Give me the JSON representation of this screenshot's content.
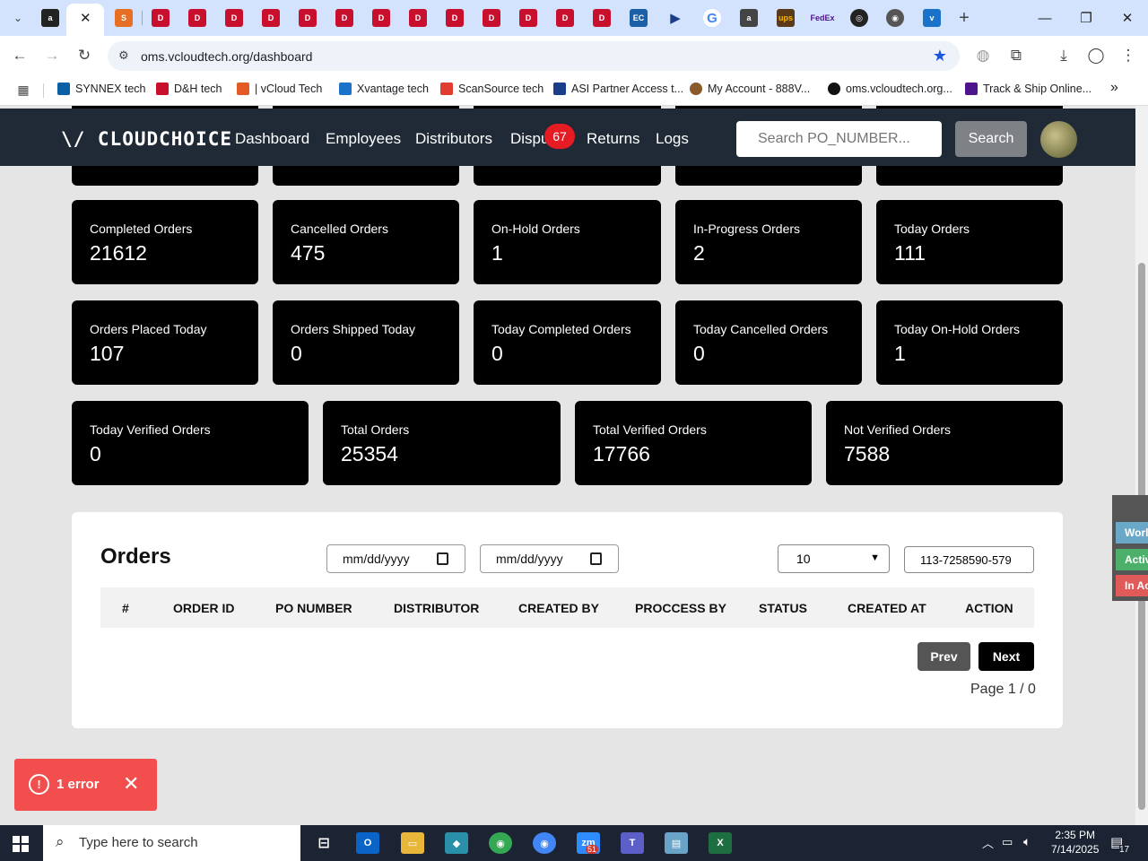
{
  "browser": {
    "url": "oms.vcloudtech.org/dashboard",
    "tab_icons": [
      "amazon-icon",
      "close-icon",
      "scansource-icon",
      "dh-icon",
      "dh-icon",
      "dh-icon",
      "dh-icon",
      "dh-icon",
      "dh-icon",
      "dh-icon",
      "dh-icon",
      "dh-icon",
      "dh-icon",
      "dh-icon",
      "dh-icon",
      "ec-icon",
      "play-icon",
      "google-icon",
      "amazon-icon",
      "ups-icon",
      "fedex-icon",
      "openai-icon",
      "chrome-icon",
      "vcloud-icon",
      "plus-icon"
    ],
    "bookmarks": [
      {
        "label": "SYNNEX tech",
        "color": "#0b5fa5"
      },
      {
        "label": "D&H tech",
        "color": "#c8102e"
      },
      {
        "label": "| vCloud Tech",
        "color": "#e25b24"
      },
      {
        "label": "Xvantage tech",
        "color": "#1a73c9"
      },
      {
        "label": "ScanSource tech",
        "color": "#e03c31"
      },
      {
        "label": "ASI Partner Access t...",
        "color": "#1a3e8a"
      },
      {
        "label": "My Account - 888V...",
        "color": "#8a5a2b"
      },
      {
        "label": "oms.vcloudtech.org...",
        "color": "#111111"
      },
      {
        "label": "Track & Ship Online...",
        "color": "#4d148c"
      }
    ],
    "bookmarks_more": "»"
  },
  "navbar": {
    "logo": "\\/ CLOUDCHOICE",
    "links": [
      "Dashboard",
      "Employees",
      "Distributors",
      "Dispu",
      "Returns",
      "Logs"
    ],
    "disputes_badge": "67",
    "search_placeholder": "Search PO_NUMBER...",
    "search_button": "Search"
  },
  "stats": [
    {
      "label": "Completed Orders",
      "value": "21612"
    },
    {
      "label": "Cancelled Orders",
      "value": "475"
    },
    {
      "label": "On-Hold Orders",
      "value": "1"
    },
    {
      "label": "In-Progress Orders",
      "value": "2"
    },
    {
      "label": "Today Orders",
      "value": "111"
    },
    {
      "label": "Orders Placed Today",
      "value": "107"
    },
    {
      "label": "Orders Shipped Today",
      "value": "0"
    },
    {
      "label": "Today Completed Orders",
      "value": "0"
    },
    {
      "label": "Today Cancelled Orders",
      "value": "0"
    },
    {
      "label": "Today On-Hold Orders",
      "value": "1"
    },
    {
      "label": "Today Verified Orders",
      "value": "0"
    },
    {
      "label": "Total Orders",
      "value": "25354"
    },
    {
      "label": "Total Verified Orders",
      "value": "17766"
    },
    {
      "label": "Not Verified Orders",
      "value": "7588"
    }
  ],
  "orders": {
    "title": "Orders",
    "date_from_placeholder": "mm/dd/yyyy",
    "date_to_placeholder": "mm/dd/yyyy",
    "page_size": "10",
    "filter_value": "113-7258590-579",
    "columns": [
      "#",
      "ORDER ID",
      "PO NUMBER",
      "DISTRIBUTOR",
      "CREATED BY",
      "PROCCESS BY",
      "STATUS",
      "CREATED AT",
      "ACTION"
    ],
    "prev": "Prev",
    "next": "Next",
    "page_info": "Page 1 / 0"
  },
  "toast": {
    "text": "1 error",
    "icon": "!",
    "close": "✕"
  },
  "side_widget": [
    {
      "label": "Worl",
      "color": "#6aa8c8"
    },
    {
      "label": "Activ",
      "color": "#4caf6a"
    },
    {
      "label": "In Ac",
      "color": "#e05a5a"
    }
  ],
  "taskbar": {
    "search_placeholder": "Type here to search",
    "time": "2:35 PM",
    "date": "7/14/2025",
    "notif_count": "17",
    "zoom_badge": "51"
  }
}
